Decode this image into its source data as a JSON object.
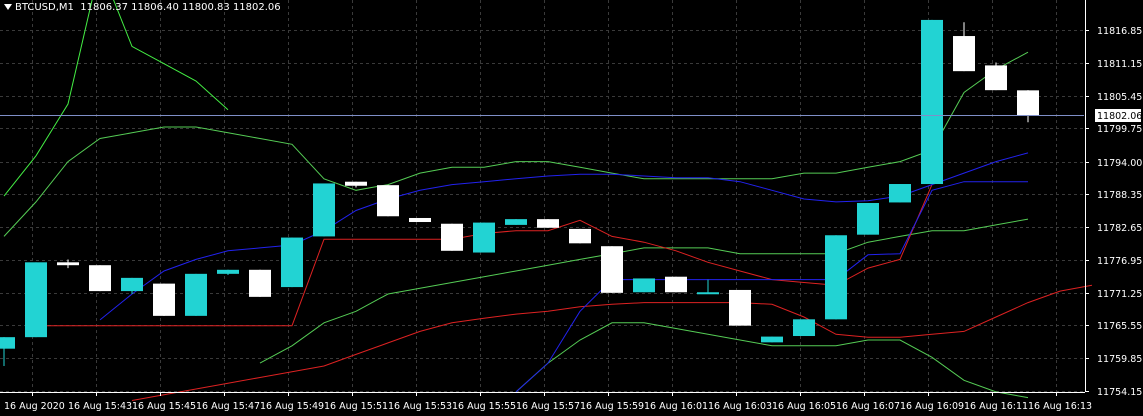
{
  "header": {
    "symbol": "BTCUSD,M1",
    "ohlc": "11806.37 11806.40 11800.83 11802.06"
  },
  "price_axis": {
    "ticks": [
      "11816.85",
      "11811.15",
      "11805.45",
      "11799.75",
      "11794.00",
      "11788.35",
      "11782.65",
      "11776.95",
      "11771.25",
      "11765.55",
      "11759.85",
      "11754.15"
    ],
    "current_price_label": "11802.06"
  },
  "time_axis": {
    "labels": [
      "16 Aug 2020",
      "16 Aug 15:43",
      "16 Aug 15:45",
      "16 Aug 15:47",
      "16 Aug 15:49",
      "16 Aug 15:51",
      "16 Aug 15:53",
      "16 Aug 15:55",
      "16 Aug 15:57",
      "16 Aug 15:59",
      "16 Aug 16:01",
      "16 Aug 16:03",
      "16 Aug 16:05",
      "16 Aug 16:07",
      "16 Aug 16:09",
      "16 Aug 16:11",
      "16 Aug 16:13"
    ]
  },
  "colors": {
    "background": "#000000",
    "grid": "#3a3a3a",
    "bull_candle": "#22d3d3",
    "bear_candle": "#ffffff",
    "axis_text": "#ffffff",
    "price_line": "#7f8fc8",
    "ma_blue": "#2222ee",
    "ma_red": "#dd2222",
    "band_green": "#55cc55"
  },
  "chart_data": {
    "type": "candlestick",
    "symbol": "BTCUSD",
    "timeframe": "M1",
    "x_start": "16 Aug 15:41",
    "ylim": [
      11754.15,
      11821.0
    ],
    "current_price": 11802.06,
    "candles": [
      {
        "o": 11761.5,
        "h": 11763.5,
        "l": 11758.5,
        "c": 11763.5
      },
      {
        "o": 11763.5,
        "h": 11776.5,
        "l": 11763.5,
        "c": 11776.5
      },
      {
        "o": 11776.5,
        "h": 11777.0,
        "l": 11775.5,
        "c": 11776.0
      },
      {
        "o": 11776.0,
        "h": 11776.0,
        "l": 11771.5,
        "c": 11771.5
      },
      {
        "o": 11771.5,
        "h": 11773.8,
        "l": 11771.0,
        "c": 11773.8
      },
      {
        "o": 11772.8,
        "h": 11772.8,
        "l": 11767.2,
        "c": 11767.2
      },
      {
        "o": 11767.2,
        "h": 11774.5,
        "l": 11767.2,
        "c": 11774.5
      },
      {
        "o": 11774.5,
        "h": 11775.2,
        "l": 11774.3,
        "c": 11775.2
      },
      {
        "o": 11775.2,
        "h": 11775.2,
        "l": 11770.5,
        "c": 11770.5
      },
      {
        "o": 11772.2,
        "h": 11780.8,
        "l": 11772.2,
        "c": 11780.8
      },
      {
        "o": 11781.0,
        "h": 11790.2,
        "l": 11781.0,
        "c": 11790.2
      },
      {
        "o": 11790.5,
        "h": 11790.5,
        "l": 11789.5,
        "c": 11789.8
      },
      {
        "o": 11789.9,
        "h": 11789.9,
        "l": 11784.5,
        "c": 11784.5
      },
      {
        "o": 11784.2,
        "h": 11784.2,
        "l": 11783.5,
        "c": 11783.5
      },
      {
        "o": 11783.2,
        "h": 11783.2,
        "l": 11778.5,
        "c": 11778.5
      },
      {
        "o": 11778.2,
        "h": 11783.4,
        "l": 11778.2,
        "c": 11783.4
      },
      {
        "o": 11783.0,
        "h": 11784.0,
        "l": 11783.0,
        "c": 11784.0
      },
      {
        "o": 11784.0,
        "h": 11784.0,
        "l": 11782.5,
        "c": 11782.5
      },
      {
        "o": 11782.3,
        "h": 11782.3,
        "l": 11779.8,
        "c": 11779.8
      },
      {
        "o": 11779.3,
        "h": 11779.3,
        "l": 11771.2,
        "c": 11771.2
      },
      {
        "o": 11771.3,
        "h": 11773.7,
        "l": 11771.3,
        "c": 11773.7
      },
      {
        "o": 11774.0,
        "h": 11774.0,
        "l": 11771.3,
        "c": 11771.3
      },
      {
        "o": 11771.3,
        "h": 11773.5,
        "l": 11771.0,
        "c": 11771.3
      },
      {
        "o": 11771.7,
        "h": 11771.7,
        "l": 11767.5,
        "c": 11765.5
      },
      {
        "o": 11762.6,
        "h": 11763.6,
        "l": 11762.6,
        "c": 11763.6
      },
      {
        "o": 11763.7,
        "h": 11766.6,
        "l": 11763.7,
        "c": 11766.6
      },
      {
        "o": 11766.6,
        "h": 11781.2,
        "l": 11766.6,
        "c": 11781.2
      },
      {
        "o": 11781.3,
        "h": 11786.8,
        "l": 11781.3,
        "c": 11786.8
      },
      {
        "o": 11786.9,
        "h": 11790.1,
        "l": 11786.9,
        "c": 11790.1
      },
      {
        "o": 11790.1,
        "h": 11818.6,
        "l": 11790.1,
        "c": 11818.6
      },
      {
        "o": 11815.8,
        "h": 11818.2,
        "l": 11809.7,
        "c": 11809.7
      },
      {
        "o": 11810.7,
        "h": 11811.2,
        "l": 11806.4,
        "c": 11806.4
      },
      {
        "o": 11806.37,
        "h": 11806.4,
        "l": 11800.83,
        "c": 11802.06
      }
    ],
    "ma_blue": [
      null,
      null,
      null,
      11766.5,
      11771.0,
      11775.0,
      11777.0,
      11778.5,
      11779.0,
      11779.5,
      11782.0,
      11785.5,
      11787.5,
      11789.0,
      11790.0,
      11790.5,
      11791.0,
      11791.5,
      11791.8,
      11791.8,
      11791.5,
      11791.2,
      11791.2,
      11790.5,
      11789.0,
      11787.5,
      11787.0,
      11787.2,
      11788.0,
      11790.0,
      11792.0,
      11794.0,
      11795.5
    ],
    "ma_red": [
      null,
      11765.5,
      11765.5,
      11765.5,
      11765.5,
      11765.5,
      11765.5,
      11765.5,
      11765.5,
      11765.5,
      11780.5,
      11780.5,
      11780.5,
      11780.5,
      11780.5,
      11781.5,
      11782.0,
      11782.0,
      11783.8,
      11781.0,
      11780.0,
      11778.5,
      11776.5,
      11775.0,
      11773.5,
      11773.0,
      11772.5,
      11775.5,
      11777.0,
      11790.0,
      null,
      null,
      null
    ],
    "blue_segment": [
      null,
      null,
      null,
      null,
      null,
      null,
      null,
      null,
      null,
      null,
      null,
      null,
      null,
      null,
      null,
      null,
      11754.0,
      11759.0,
      11768.0,
      11773.5,
      11773.5,
      11773.5,
      11773.5,
      11773.5,
      11773.5,
      11773.5,
      11773.5,
      11777.8,
      11778.0,
      11789.0,
      11790.5,
      11790.5,
      11790.5
    ],
    "red_segment": [
      null,
      null,
      null,
      null,
      11752.5,
      11753.5,
      11754.5,
      11755.5,
      11756.5,
      11757.5,
      11758.5,
      11760.5,
      11762.5,
      11764.5,
      11766.0,
      11766.8,
      11767.5,
      11768.0,
      11768.8,
      11769.2,
      11769.5,
      11769.5,
      11769.5,
      11769.5,
      11769.2,
      11767.0,
      11764.0,
      11763.5,
      11763.5,
      11764.0,
      11764.5,
      11767.0,
      11769.5,
      11771.5,
      11772.5
    ],
    "band_upper": [
      11788,
      11795,
      11804,
      11828,
      11814,
      11811,
      11808,
      11803,
      null,
      null,
      null,
      null,
      null,
      null,
      null,
      null,
      null,
      null,
      null,
      null,
      null,
      null,
      null,
      null,
      null,
      null,
      null,
      null,
      null,
      null,
      null,
      null,
      null
    ],
    "band_mid_upper": [
      11781,
      11787,
      11794,
      11798,
      11799,
      11800,
      11800,
      11799,
      11798,
      11797,
      11791,
      11789,
      11790,
      11792,
      11793,
      11793,
      11794,
      11794,
      11793,
      11792,
      11791,
      11791,
      11791,
      11791,
      11791,
      11792,
      11792,
      11793,
      11794,
      11796,
      11806,
      11810,
      11813
    ],
    "band_mid_lower": [
      null,
      null,
      null,
      null,
      null,
      null,
      null,
      null,
      11759,
      11762,
      11766,
      11768,
      11771,
      11772,
      11773,
      11774,
      11775,
      11776,
      11777,
      11778,
      11779,
      11779,
      11779,
      11778,
      11778,
      11778,
      11778,
      11780,
      11781,
      11782,
      11782,
      11783,
      11784
    ],
    "band_lower": [
      null,
      null,
      null,
      null,
      null,
      11754,
      11758,
      11762,
      11766,
      11771,
      11775,
      11777,
      11779,
      11779,
      11780,
      11781,
      11782,
      11783,
      11783,
      11783,
      11782,
      11781,
      11779,
      11776,
      11774,
      11774,
      11774,
      11775,
      11775,
      11776,
      11776,
      11776,
      11777
    ],
    "band_lowest": [
      null,
      null,
      null,
      null,
      null,
      null,
      null,
      null,
      null,
      null,
      null,
      null,
      null,
      null,
      null,
      null,
      11754,
      11759,
      11763,
      11766,
      11766,
      11765,
      11764,
      11763,
      11762,
      11762,
      11762,
      11763,
      11763,
      11760,
      11756,
      11754,
      11753
    ]
  }
}
